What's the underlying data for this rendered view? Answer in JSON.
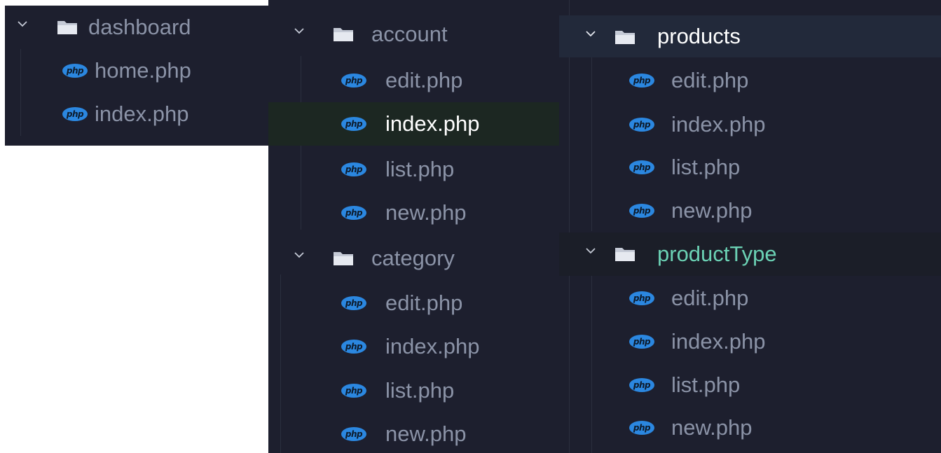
{
  "icons": {
    "folder": "folder-icon",
    "chevron": "chevron-down-icon",
    "php": "php-file-icon"
  },
  "colors": {
    "panel_bg": "#1d1f2e",
    "file_text": "#8b93a7",
    "active_text": "#ffffff",
    "folder_highlight_text": "#6bd1b4",
    "php_icon": "#2b87e0"
  },
  "panels": [
    {
      "folders": [
        {
          "name": "dashboard",
          "expanded": true,
          "files": [
            "home.php",
            "index.php"
          ]
        }
      ]
    },
    {
      "folders": [
        {
          "name": "account",
          "expanded": true,
          "files": [
            "edit.php",
            "index.php",
            "list.php",
            "new.php"
          ],
          "selected_file": "index.php"
        },
        {
          "name": "category",
          "expanded": true,
          "files": [
            "edit.php",
            "index.php",
            "list.php",
            "new.php"
          ]
        }
      ]
    },
    {
      "folders": [
        {
          "name": "products",
          "expanded": true,
          "files": [
            "edit.php",
            "index.php",
            "list.php",
            "new.php"
          ]
        },
        {
          "name": "productType",
          "expanded": true,
          "files": [
            "edit.php",
            "index.php",
            "list.php",
            "new.php"
          ]
        }
      ]
    }
  ]
}
